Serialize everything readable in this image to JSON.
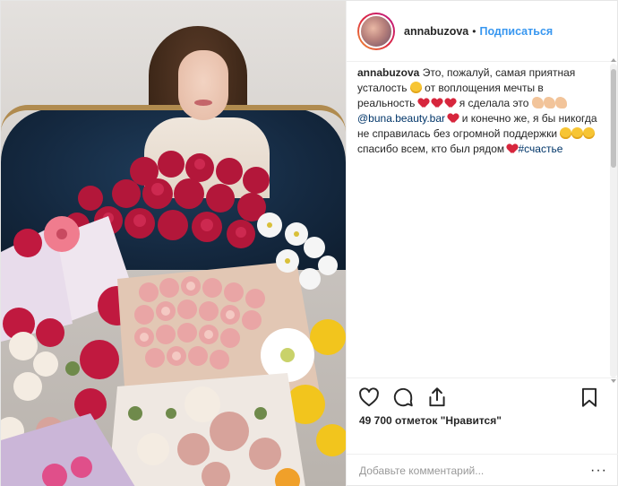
{
  "post": {
    "header": {
      "username": "annabuzova",
      "separator": "•",
      "follow_label": "Подписаться"
    },
    "caption": {
      "username": "annabuzova",
      "text_1": "Это, пожалуй, самая приятная усталость",
      "text_2": "от воплощения мечты в реальность",
      "text_3": "я сделала это",
      "mention": "@buna.beauty.bar",
      "text_4": "и конечно же, я бы никогда не справилась без огромной поддержки",
      "text_5": "спасибо всем, кто был рядом",
      "hashtag": "#счастье"
    },
    "likes_text": "49 700 отметок \"Нравится\"",
    "comment_input": {
      "placeholder": "Добавьте комментарий...",
      "value": ""
    },
    "more_label": "···"
  },
  "icons": {
    "like": "heart-outline-icon",
    "comment": "comment-bubble-icon",
    "share": "share-upload-icon",
    "save": "bookmark-icon",
    "more": "more-options-icon"
  },
  "colors": {
    "link_blue": "#3897f0",
    "mention": "#003569",
    "text": "#262626",
    "placeholder": "#999999",
    "border": "#efefef"
  }
}
